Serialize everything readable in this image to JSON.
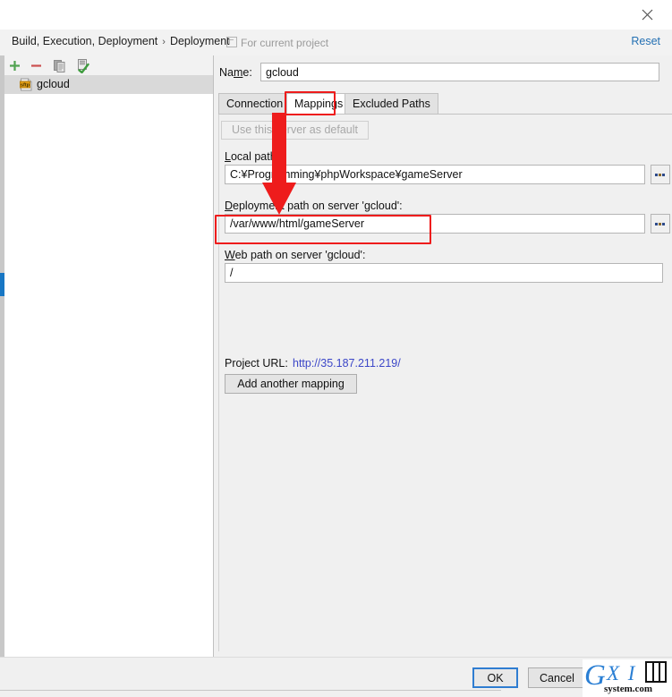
{
  "window": {
    "close_icon": "close-icon"
  },
  "breadcrumb": {
    "root": "Build, Execution, Deployment",
    "separator": "›",
    "leaf": "Deployment",
    "scope_label": "For current project",
    "reset_label": "Reset"
  },
  "sidebar": {
    "toolbar": [
      {
        "name": "add-server-button",
        "icon": "plus-icon",
        "color": "#4caf50"
      },
      {
        "name": "remove-server-button",
        "icon": "minus-icon",
        "color": "#d9534f"
      },
      {
        "name": "copy-server-button",
        "icon": "copy-icon",
        "color": "#8a8a8a"
      },
      {
        "name": "validate-server-button",
        "icon": "check-document-icon",
        "color": "#4caf50"
      }
    ],
    "servers": [
      {
        "label": "gcloud",
        "icon": "sftp-icon",
        "selected": true
      }
    ]
  },
  "form": {
    "name_label": "Name:",
    "name_label_mnemonic": "m",
    "name_value": "gcloud",
    "tabs": [
      {
        "label": "Connection",
        "selected": false
      },
      {
        "label": "Mappings",
        "selected": true
      },
      {
        "label": "Excluded Paths",
        "selected": false
      }
    ],
    "use_default_button": "Use this server as default",
    "fields": [
      {
        "label": "Local path:",
        "mnemonic": "L",
        "value": "C:¥Programming¥phpWorkspace¥gameServer",
        "browse_label": "...",
        "has_browse": true
      },
      {
        "label": "Deployment path on server 'gcloud':",
        "mnemonic": "D",
        "value": "/var/www/html/gameServer",
        "browse_label": "...",
        "has_browse": true
      },
      {
        "label": "Web path on server 'gcloud':",
        "mnemonic": "W",
        "value": "/",
        "browse_label": "",
        "has_browse": false
      }
    ],
    "project_url_label": "Project URL:",
    "project_url_value": "http://35.187.211.219/",
    "add_mapping_button": "Add another mapping"
  },
  "footer": {
    "ok_label": "OK",
    "cancel_label": "Cancel"
  },
  "annotations": {
    "highlight_color": "#ee1c1c",
    "tab_box_target": "Mappings",
    "field_box_target": "/var/www/html/gameServer",
    "arrow": "down-arrow"
  },
  "watermark": {
    "letter_g": "G",
    "letters_xi": "X I",
    "domain": "system.com"
  }
}
